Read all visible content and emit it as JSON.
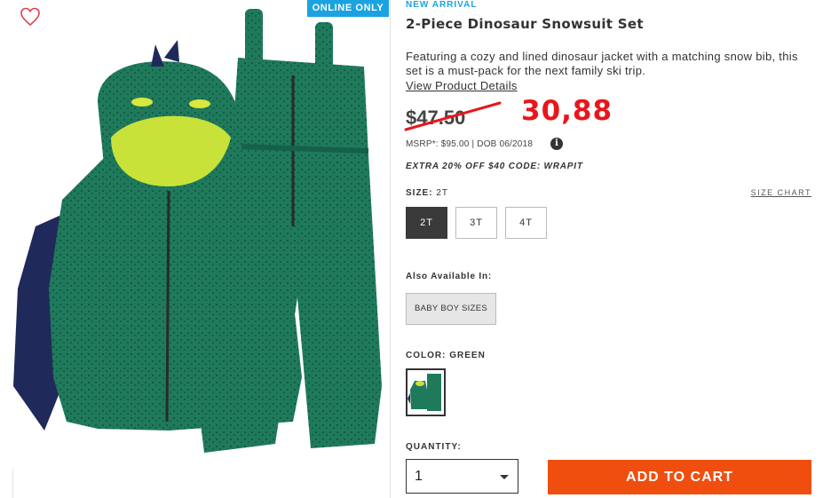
{
  "badge": "ONLINE ONLY",
  "product": {
    "tag": "NEW ARRIVAL",
    "title": "2-Piece Dinosaur Snowsuit Set",
    "description": "Featuring a cozy and lined dinosaur jacket with a matching snow bib, this set is a must-pack for the next family ski trip.",
    "view_details": "View Product Details",
    "old_price": "$47.50",
    "new_price": "30,88",
    "msrp": "MSRP*: $95.00 | DOB 06/2018",
    "info_icon": "i",
    "promo": "EXTRA 20% OFF $40 CODE: WRAPIT"
  },
  "size": {
    "label": "SIZE:",
    "selected": "2T",
    "chart_link": "SIZE CHART",
    "options": [
      "2T",
      "3T",
      "4T"
    ]
  },
  "also": {
    "label": "Also Available In:",
    "button": "BABY BOY SIZES"
  },
  "color": {
    "label": "COLOR:",
    "selected": "GREEN"
  },
  "quantity": {
    "label": "QUANTITY:",
    "value": "1"
  },
  "cart": {
    "label": "ADD TO CART"
  },
  "colors": {
    "accent_blue": "#1aa3e0",
    "price_red": "#e8161c",
    "cart_orange": "#f04e0f",
    "product_green": "#1f7a5c"
  },
  "icons": [
    "heart-icon",
    "info-icon",
    "chevron-down-icon"
  ]
}
